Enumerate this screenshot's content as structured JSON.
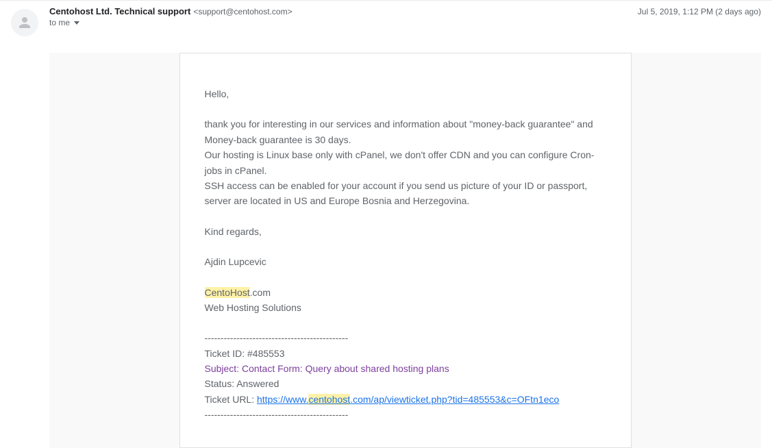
{
  "header": {
    "sender_name": "Centohost Ltd. Technical support",
    "sender_email": "<support@centohost.com>",
    "timestamp": "Jul 5, 2019, 1:12 PM (2 days ago)",
    "recipient": "to me"
  },
  "body": {
    "greeting": "Hello,",
    "p1": "thank you for interesting in our services and information about \"money-back guarantee\" and Money-back guarantee is 30 days.",
    "p2": "Our hosting is Linux base only with cPanel, we don't offer CDN and you can configure Cron-jobs in cPanel.",
    "p3": "SSH access can be enabled for your account if you send us picture of your ID or passport, server are located in US and Europe Bosnia and Herzegovina.",
    "regards": "Kind regards,",
    "signature_name": "Ajdin Lupcevic",
    "sig_company_highlight": "CentoHost",
    "sig_company_rest": ".com",
    "sig_tagline": "Web Hosting Solutions",
    "divider": "---------------------------------------------",
    "ticket_id_label": "Ticket ID: ",
    "ticket_id": "#485553",
    "subject_label": "Subject: ",
    "subject": "Contact Form: Query about shared hosting plans",
    "status_label": "Status: ",
    "status": "Answered",
    "ticket_url_label": "Ticket URL: ",
    "ticket_url_pre": "https://www.",
    "ticket_url_highlight": "centohost",
    "ticket_url_post": ".com/ap/viewticket.php?tid=485553&c=OFtn1eco"
  }
}
